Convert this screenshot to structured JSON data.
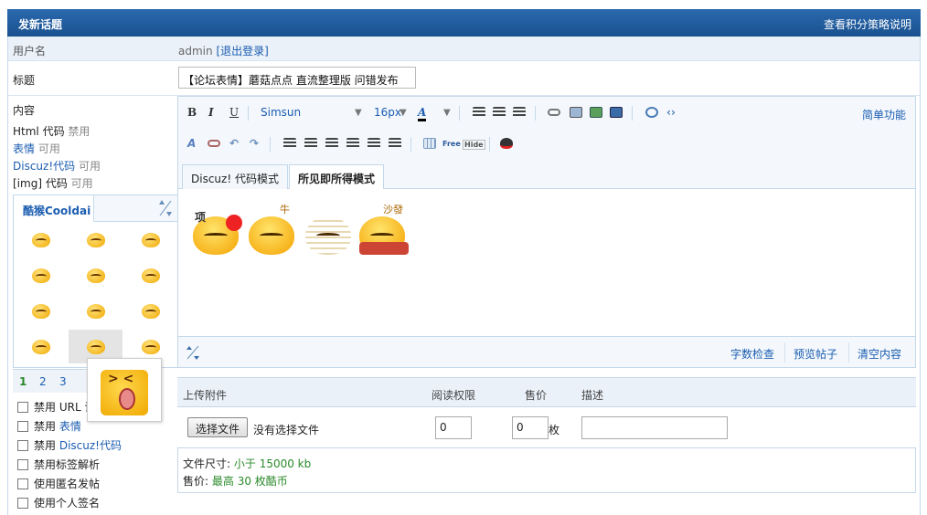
{
  "header": {
    "title": "发新话题",
    "link": "查看积分策略说明"
  },
  "user": {
    "label": "用户名",
    "name": "admin",
    "logout": "[退出登录]"
  },
  "title_field": {
    "label": "标题",
    "value": "【论坛表情】蘑菇点点 直流整理版 问错发布"
  },
  "content": {
    "label": "内容",
    "modes": [
      {
        "name": "Html 代码",
        "state": "禁用"
      },
      {
        "name": "表情",
        "state": "可用"
      },
      {
        "name": "Discuz!代码",
        "state": "可用"
      },
      {
        "name": "[img] 代码",
        "state": "可用"
      }
    ]
  },
  "smilies": {
    "tab_label": "酷猴Cooldai",
    "pages": [
      "1",
      "2",
      "3"
    ],
    "current_page": "1",
    "icons": [
      "smiley-1",
      "smiley-2",
      "smiley-3",
      "smiley-4",
      "smiley-5",
      "smiley-6",
      "smiley-7",
      "smiley-8",
      "smiley-9",
      "smiley-10",
      "smiley-11",
      "smiley-12"
    ]
  },
  "options": [
    {
      "prefix": "禁用",
      "text": "URL 识别",
      "blue": false
    },
    {
      "prefix": "禁用",
      "text": "表情",
      "blue": true
    },
    {
      "prefix": "禁用",
      "text": "Discuz!代码",
      "blue": true
    },
    {
      "prefix": "禁用",
      "text": "标签解析",
      "blue": false
    },
    {
      "prefix": "使用匿名发帖",
      "text": "",
      "blue": false
    },
    {
      "prefix": "使用个人签名",
      "text": "",
      "blue": false
    }
  ],
  "toolbar": {
    "font": "Simsun",
    "size": "16px",
    "simple": "简单功能",
    "free": "Free",
    "hide": "Hide"
  },
  "editor_tabs": {
    "code": "Discuz! 代码模式",
    "wysiwyg": "所见即所得模式"
  },
  "editor_content": {
    "faces": [
      "face-1",
      "face-2",
      "face-3",
      "face-4"
    ],
    "caption_1": "项",
    "caption_2": "牛",
    "caption_3": "沙發"
  },
  "status_buttons": {
    "wordcount": "字数检查",
    "preview": "预览帖子",
    "clear": "清空内容"
  },
  "upload": {
    "col_upload": "上传附件",
    "col_perm": "阅读权限",
    "col_price": "售价",
    "col_desc": "描述",
    "choose": "选择文件",
    "nofile": "没有选择文件",
    "perm_value": "0",
    "price_value": "0",
    "price_unit": "枚"
  },
  "info": {
    "size_label": "文件尺寸:",
    "size_value": "小于 15000 kb",
    "price_label": "售价:",
    "price_value": "最高 30 枚酷币"
  },
  "colors": {
    "header": "#1f5a9c",
    "link": "#1a5cb0",
    "green": "#2b8a2b"
  }
}
